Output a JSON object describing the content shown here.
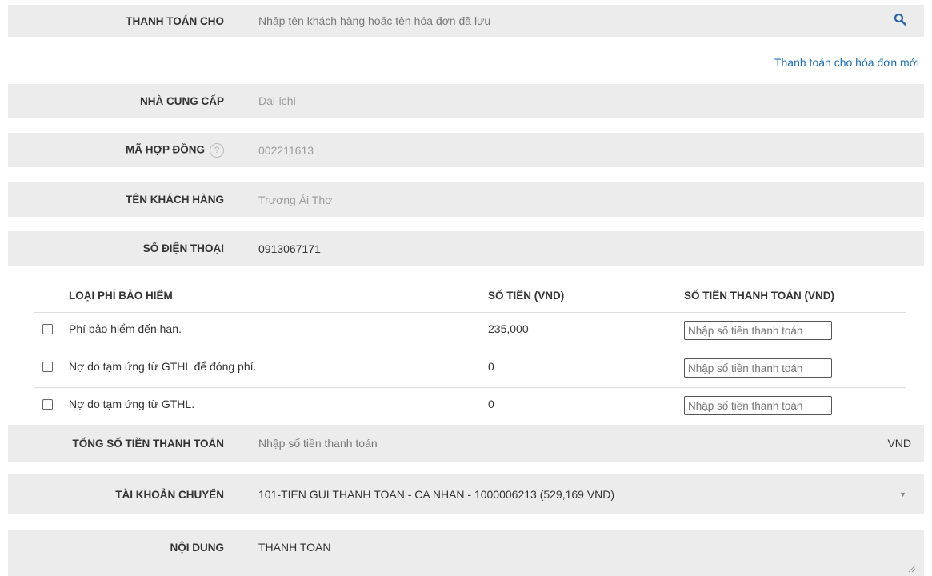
{
  "pay_for": {
    "label": "THANH TOÁN CHO",
    "placeholder": "Nhập tên khách hàng hoặc tên hóa đơn đã lưu"
  },
  "new_bill_link": "Thanh toán cho hóa đơn mới",
  "provider": {
    "label": "NHÀ CUNG CẤP",
    "value": "Dai-ichi"
  },
  "contract": {
    "label": "MÃ HỢP ĐỒNG",
    "help": "?",
    "value": "002211613"
  },
  "customer": {
    "label": "TÊN KHÁCH HÀNG",
    "value": "Trương Ái Thơ"
  },
  "phone": {
    "label": "SỐ ĐIỆN THOẠI",
    "value": "0913067171"
  },
  "fees_table": {
    "headers": [
      "LOẠI PHÍ BẢO HIỂM",
      "SỐ TIỀN (VND)",
      "SỐ TIỀN THANH TOÁN (VND)"
    ],
    "rows": [
      {
        "name": "Phí bảo hiểm đến hạn.",
        "amount": "235,000",
        "checked": false
      },
      {
        "name": "Nợ do tạm ứng từ GTHL để đóng phí.",
        "amount": "0",
        "checked": false
      },
      {
        "name": "Nợ do tạm ứng từ GTHL.",
        "amount": "0",
        "checked": false
      }
    ],
    "input_placeholder": "Nhập số tiền thanh toán"
  },
  "total": {
    "label": "TỔNG SỐ TIỀN THANH TOÁN",
    "placeholder": "Nhập số tiền thanh toán",
    "currency": "VND"
  },
  "account": {
    "label": "TÀI KHOẢN CHUYỂN",
    "value": "101-TIEN GUI THANH TOAN - CA NHAN - 1000006213 (529,169 VND)"
  },
  "content": {
    "label": "NỘI DUNG",
    "value": "THANH TOAN"
  },
  "colors": {
    "row_bg": "#ececec",
    "link": "#1f6fb0",
    "icon": "#2a64a8"
  }
}
